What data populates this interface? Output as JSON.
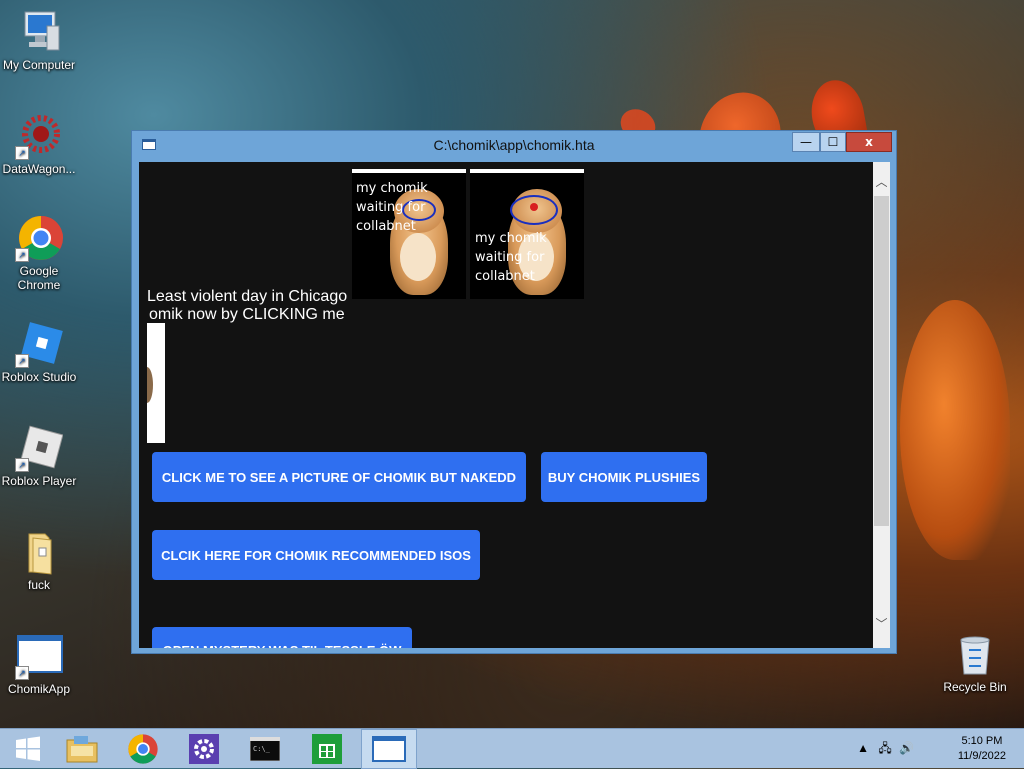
{
  "desktop": {
    "icons": [
      {
        "label": "My Computer",
        "icon": "computer-icon"
      },
      {
        "label": "DataWagon...",
        "icon": "datawagon-icon"
      },
      {
        "label": "Google Chrome",
        "icon": "chrome-icon"
      },
      {
        "label": "Roblox Studio",
        "icon": "roblox-studio-icon"
      },
      {
        "label": "Roblox Player",
        "icon": "roblox-player-icon"
      },
      {
        "label": "fuck",
        "icon": "folder-icon"
      },
      {
        "label": "ChomikApp",
        "icon": "window-app-icon"
      },
      {
        "label": "Recycle Bin",
        "icon": "recycle-bin-icon"
      }
    ]
  },
  "window": {
    "title": "C:\\chomik\\app\\chomik.hta",
    "controls": {
      "minimize": "—",
      "maximize": "☐",
      "close": "x"
    }
  },
  "content": {
    "hamster_images": [
      {
        "caption_line1": "my chomik",
        "caption_line2": "waiting for",
        "caption_line3": "collabnet"
      },
      {
        "caption_line1": "my chomik",
        "caption_line2": "waiting for",
        "caption_line3": "collabnet"
      }
    ],
    "headline": "Least violent day in Chicago",
    "subline": "omik now by CLICKING me",
    "buttons": {
      "naked": "CLICK ME TO SEE A PICTURE OF CHOMIK BUT NAKEDD",
      "plushies": "BUY CHOMIK PLUSHIES",
      "isos": "CLCIK HERE FOR CHOMIK RECOMMENDED ISOS",
      "partial": "OPEN MYSTERY WAS TIL TESSLE ÖW"
    }
  },
  "taskbar": {
    "items": [
      "start-icon",
      "file-explorer-icon",
      "chrome-icon",
      "settings-icon",
      "cmd-icon",
      "store-icon",
      "window-app-icon"
    ],
    "time": "5:10 PM",
    "date": "11/9/2022"
  },
  "colors": {
    "button_blue": "#2f6ff0",
    "window_frame": "#6ea5d8",
    "client_bg": "#121212"
  }
}
